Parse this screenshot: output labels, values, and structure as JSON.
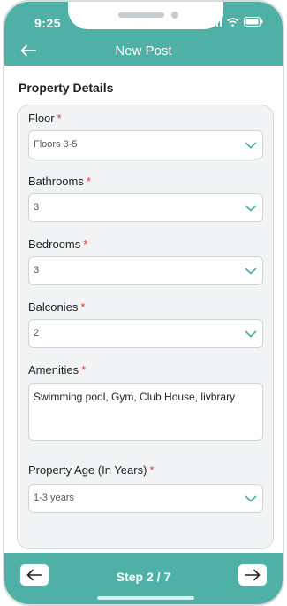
{
  "status_bar": {
    "time": "9:25"
  },
  "app_bar": {
    "title": "New Post",
    "back_icon": "arrow-left-icon"
  },
  "section": {
    "title": "Property Details"
  },
  "form": {
    "floor": {
      "label": "Floor",
      "required": "*",
      "value": "Floors 3-5"
    },
    "bathrooms": {
      "label": "Bathrooms",
      "required": "*",
      "value": "3"
    },
    "bedrooms": {
      "label": "Bedrooms",
      "required": "*",
      "value": "3"
    },
    "balconies": {
      "label": "Balconies",
      "required": "*",
      "value": "2"
    },
    "amenities": {
      "label": "Amenities",
      "required": "*",
      "value": "Swimming pool, Gym, Club House, livbrary"
    },
    "property_age": {
      "label": "Property Age (In Years)",
      "required": "*",
      "value": "1-3 years"
    }
  },
  "footer": {
    "step": "Step 2 / 7",
    "prev_icon": "arrow-left-icon",
    "next_icon": "arrow-right-icon"
  },
  "colors": {
    "accent": "#4fb0a6",
    "required": "#e23b3b",
    "card_bg": "#f2f3f4"
  }
}
